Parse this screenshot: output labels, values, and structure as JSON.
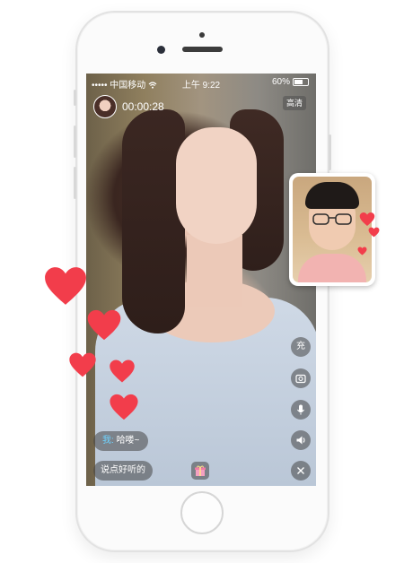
{
  "status_bar": {
    "carrier": "中国移动",
    "time": "上午 9:22",
    "battery": "60%"
  },
  "call": {
    "duration": "00:00:28",
    "quality_badge": "高清"
  },
  "actions": {
    "recharge_label": "充"
  },
  "chat": {
    "sender": "我:",
    "message": "哈喽~",
    "input_placeholder": "说点好听的"
  },
  "colors": {
    "heart": "#f23d4b",
    "chat_name": "#6fd3ff",
    "overlay": "rgba(70,70,70,0.55)"
  },
  "icons": [
    "camera-switch-icon",
    "microphone-icon",
    "speaker-icon",
    "close-icon",
    "gift-icon",
    "heart-icon",
    "wifi-icon"
  ]
}
